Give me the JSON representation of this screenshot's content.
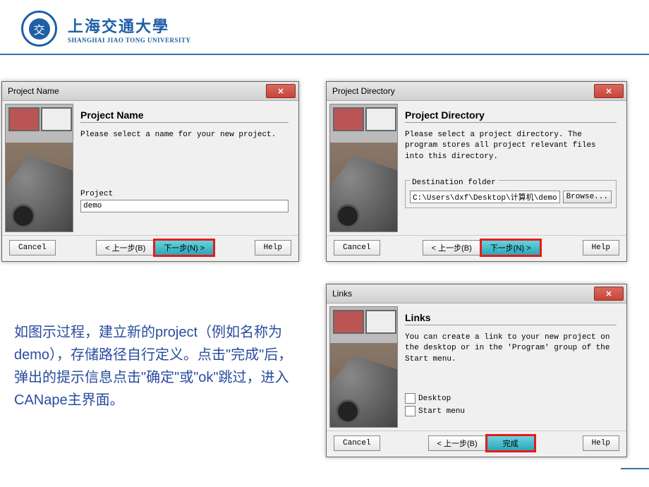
{
  "header": {
    "uni_cn": "上海交通大學",
    "uni_en": "SHANGHAI JIAO TONG UNIVERSITY"
  },
  "dialog1": {
    "title": "Project Name",
    "heading": "Project Name",
    "desc": "Please select a name for your new project.",
    "field_label": "Project",
    "field_value": "demo",
    "cancel": "Cancel",
    "back": "< 上一步(B)",
    "next": "下一步(N) >",
    "help": "Help"
  },
  "dialog2": {
    "title": "Project Directory",
    "heading": "Project Directory",
    "desc": "Please select a project directory. The program stores all project relevant files into this directory.",
    "legend": "Destination folder",
    "path": "C:\\Users\\dxf\\Desktop\\计算机\\demo",
    "browse": "Browse...",
    "cancel": "Cancel",
    "back": "< 上一步(B)",
    "next": "下一步(N) >",
    "help": "Help"
  },
  "dialog3": {
    "title": "Links",
    "heading": "Links",
    "desc": "You can create a link to your new project on the desktop or in the 'Program' group of the Start menu.",
    "cb1": "Desktop",
    "cb2": "Start menu",
    "cancel": "Cancel",
    "back": "< 上一步(B)",
    "finish": "完成",
    "help": "Help"
  },
  "instruction": "如图示过程，建立新的project（例如名称为demo），存储路径自行定义。点击\"完成\"后，弹出的提示信息点击\"确定\"或\"ok\"跳过，进入CANape主界面。"
}
